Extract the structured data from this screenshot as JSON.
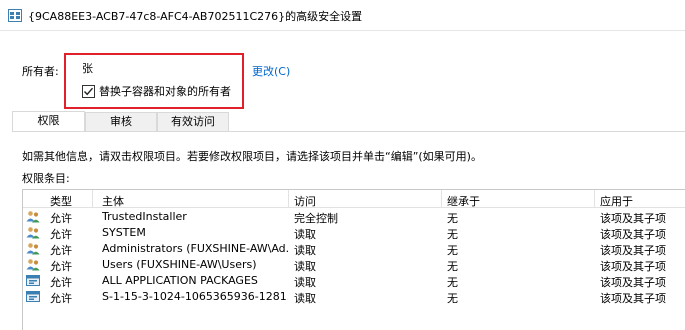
{
  "window": {
    "title": "{9CA88EE3-ACB7-47c8-AFC4-AB702511C276}的高级安全设置"
  },
  "owner": {
    "label": "所有者:",
    "value": "张",
    "change_link": "更改(C)",
    "replace_checkbox_label": "替换子容器和对象的所有者",
    "replace_checked": true
  },
  "tabs": [
    "权限",
    "审核",
    "有效访问"
  ],
  "active_tab": 0,
  "info_text": "如需其他信息，请双击权限项目。若要修改权限项目，请选择该项目并单击“编辑”(如果可用)。",
  "entries_label": "权限条目:",
  "table": {
    "headers": [
      "类型",
      "主体",
      "访问",
      "继承于",
      "应用于"
    ],
    "rows": [
      {
        "icon": "user-group-icon",
        "type": "允许",
        "principal": "TrustedInstaller",
        "access": "完全控制",
        "inherited": "无",
        "applies": "该项及其子项"
      },
      {
        "icon": "user-group-icon",
        "type": "允许",
        "principal": "SYSTEM",
        "access": "读取",
        "inherited": "无",
        "applies": "该项及其子项"
      },
      {
        "icon": "user-group-icon",
        "type": "允许",
        "principal": "Administrators (FUXSHINE-AW\\Ad...",
        "access": "读取",
        "inherited": "无",
        "applies": "该项及其子项"
      },
      {
        "icon": "user-group-icon",
        "type": "允许",
        "principal": "Users (FUXSHINE-AW\\Users)",
        "access": "读取",
        "inherited": "无",
        "applies": "该项及其子项"
      },
      {
        "icon": "app-package-icon",
        "type": "允许",
        "principal": "ALL APPLICATION PACKAGES",
        "access": "读取",
        "inherited": "无",
        "applies": "该项及其子项"
      },
      {
        "icon": "app-package-icon",
        "type": "允许",
        "principal": "S-1-15-3-1024-1065365936-1281...",
        "access": "读取",
        "inherited": "无",
        "applies": "该项及其子项"
      }
    ]
  },
  "colors": {
    "link": "#0066cc",
    "highlight": "#e0202a"
  }
}
